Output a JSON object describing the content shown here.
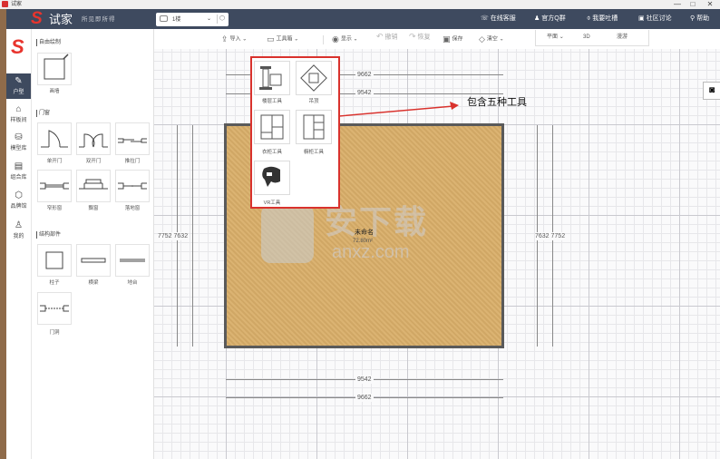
{
  "window": {
    "title": "试家",
    "controls": [
      "—",
      "□",
      "✕"
    ]
  },
  "app": {
    "logo_mark": "S",
    "logo_text": "试家",
    "logo_sub": "所见即所得"
  },
  "floor_selector": {
    "value": "1楼"
  },
  "top_links": [
    {
      "label": "在线客服",
      "icon": "phone-icon",
      "glyph": "☏"
    },
    {
      "label": "官方Q群",
      "icon": "qq-icon",
      "glyph": "♟"
    },
    {
      "label": "我要吐槽",
      "icon": "mic-icon",
      "glyph": "🎙"
    },
    {
      "label": "社区讨论",
      "icon": "forum-icon",
      "glyph": "▣"
    },
    {
      "label": "帮助",
      "icon": "help-icon",
      "glyph": "⚲"
    }
  ],
  "toolbar": {
    "import_label": "导入",
    "toolbox_label": "工具箱",
    "display_label": "显示",
    "undo_label": "撤销",
    "redo_label": "恢复",
    "save_label": "保存",
    "clear_label": "清空"
  },
  "view_tabs": [
    "平面",
    "3D",
    "漫游"
  ],
  "rail": {
    "items": [
      {
        "label": "户型",
        "icon": "pencil-icon",
        "glyph": "✎",
        "active": true
      },
      {
        "label": "样板间",
        "icon": "home-icon",
        "glyph": "⌂",
        "active": false
      },
      {
        "label": "模型库",
        "icon": "sofa-icon",
        "glyph": "⛁",
        "active": false
      },
      {
        "label": "组合库",
        "icon": "image-icon",
        "glyph": "▤",
        "active": false
      },
      {
        "label": "品牌馆",
        "icon": "brand-icon",
        "glyph": "⬡",
        "active": false
      },
      {
        "label": "我的",
        "icon": "user-icon",
        "glyph": "♙",
        "active": false
      }
    ]
  },
  "library": {
    "sections": [
      {
        "title": "自由绘制",
        "items": [
          "画墙"
        ]
      },
      {
        "title": "门窗",
        "items": [
          "单开门",
          "双开门",
          "推拉门",
          "窄形窗",
          "飘窗",
          "落地窗"
        ]
      },
      {
        "title": "结构部件",
        "items": [
          "柱子",
          "横梁",
          "地台",
          "门洞"
        ]
      }
    ]
  },
  "dimensions": {
    "outer_width": "9662",
    "inner_width": "9542",
    "left_height": "7752 7632",
    "right_height": "7632 7752"
  },
  "room": {
    "name": "未命名",
    "area": "72.80m²"
  },
  "toolbox_popup": {
    "items": [
      "楼层工具",
      "吊顶",
      "衣柜工具",
      "橱柜工具",
      "VR工具"
    ]
  },
  "annotation": "包含五种工具",
  "watermark": {
    "text": "安下载",
    "url": "anxz.com"
  },
  "colors": {
    "topbar": "#3e4a5f",
    "brand_red": "#e8342d",
    "floor_wood": "#d9ae69",
    "highlight": "#d9322d"
  }
}
